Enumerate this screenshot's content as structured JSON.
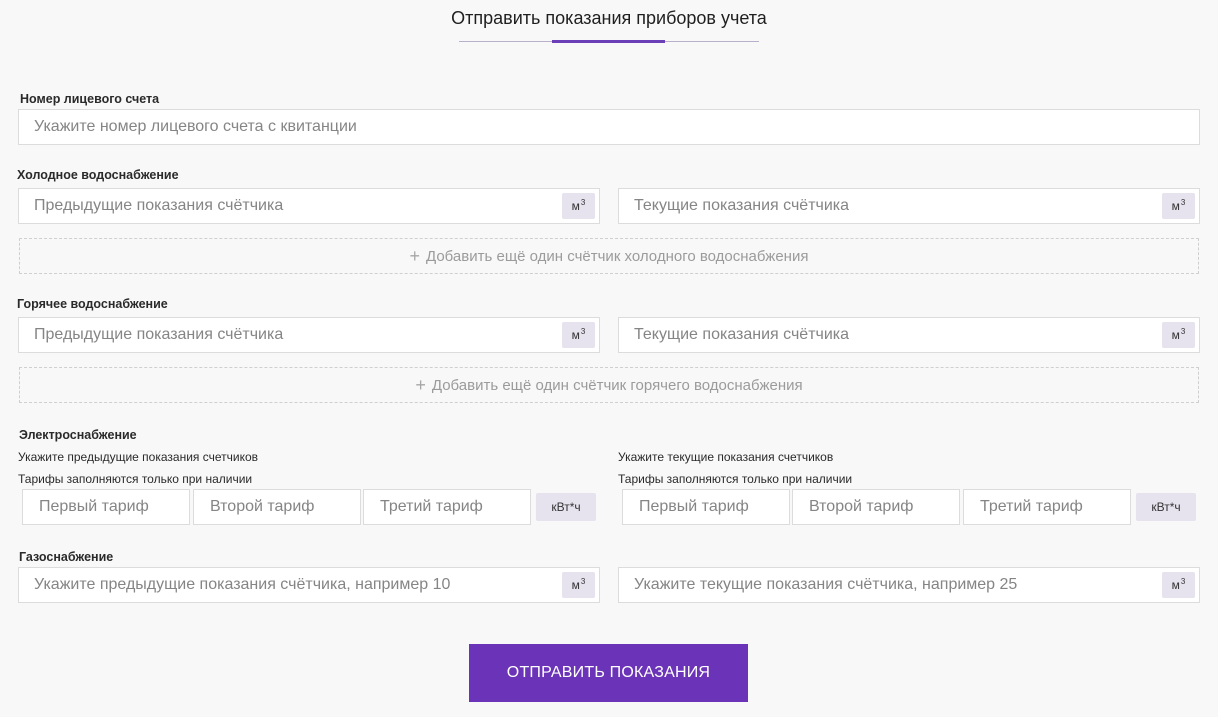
{
  "title": "Отправить показания приборов учета",
  "account": {
    "label": "Номер лицевого счета",
    "placeholder": "Укажите номер лицевого счета с квитанции"
  },
  "cold_water": {
    "label": "Холодное водоснабжение",
    "previous_placeholder": "Предыдущие показания счётчика",
    "current_placeholder": "Текущие показания счётчика",
    "unit": "м",
    "unit_sup": "3",
    "add_label": "Добавить ещё один счётчик холодного водоснабжения"
  },
  "hot_water": {
    "label": "Горячее водоснабжение",
    "previous_placeholder": "Предыдущие показания счётчика",
    "current_placeholder": "Текущие показания счётчика",
    "unit": "м",
    "unit_sup": "3",
    "add_label": "Добавить ещё один счётчик горячего водоснабжения"
  },
  "electricity": {
    "label": "Электроснабжение",
    "previous_hint": "Укажите предыдущие показания счетчиков",
    "current_hint": "Укажите текущие показания счетчиков",
    "tariff_note": "Тарифы заполняются только при наличии",
    "tariff1": "Первый тариф",
    "tariff2": "Второй тариф",
    "tariff3": "Третий тариф",
    "unit": "кВт*ч"
  },
  "gas": {
    "label": "Газоснабжение",
    "previous_placeholder": "Укажите предыдущие показания счётчика, например 10",
    "current_placeholder": "Укажите текущие показания счётчика, например 25",
    "unit": "м",
    "unit_sup": "3"
  },
  "submit_label": "ОТПРАВИТЬ ПОКАЗАНИЯ",
  "icons": {
    "add": "plus-icon"
  },
  "colors": {
    "accent": "#6b34b8",
    "unit_bg": "#e6e2ee",
    "background": "#f8f8f9"
  }
}
